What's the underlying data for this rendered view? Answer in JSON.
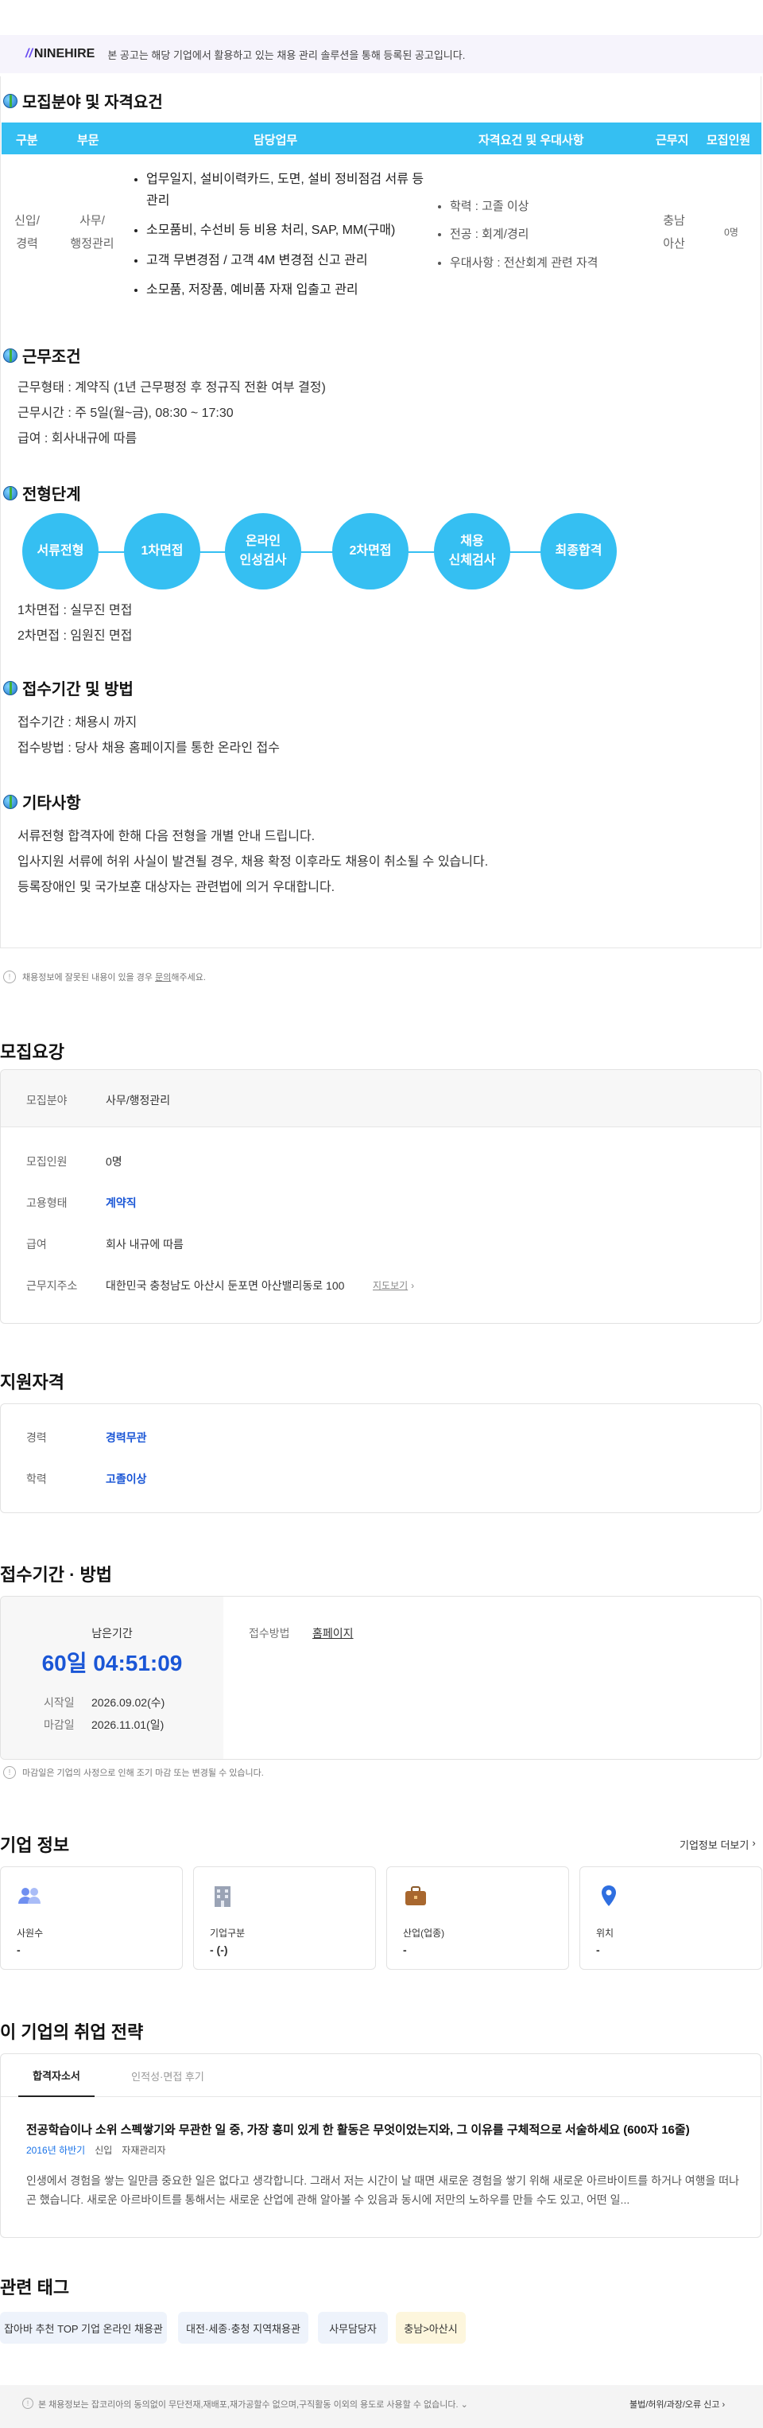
{
  "banner": {
    "logo": "NINEHIRE",
    "text": "본 공고는 해당 기업에서 활용하고 있는 채용 관리 솔루션을 통해 등록된 공고입니다."
  },
  "recruit": {
    "title": "모집분야 및 자격요건",
    "headers": [
      "구분",
      "부문",
      "담당업무",
      "자격요건 및 우대사항",
      "근무지",
      "모집인원"
    ],
    "row": {
      "type": "신입/\n경력",
      "dept": "사무/\n행정관리",
      "duties": [
        "업무일지, 설비이력카드, 도면, 설비 정비점검 서류 등 관리",
        "소모품비, 수선비 등 비용 처리, SAP, MM(구매)",
        "고객 무변경점 / 고객 4M 변경점 신고 관리",
        "소모품, 저장품, 예비품 자재 입출고 관리"
      ],
      "quals": [
        "학력 : 고졸 이상",
        "전공 : 회계/경리",
        "우대사항 : 전산회계 관련 자격"
      ],
      "location": "충남\n아산",
      "count": "0명"
    }
  },
  "conditions": {
    "title": "근무조건",
    "lines": [
      "근무형태 : 계약직 (1년 근무평정 후 정규직 전환 여부 결정)",
      "근무시간 : 주 5일(월~금), 08:30 ~ 17:30",
      "급여 : 회사내규에 따름"
    ]
  },
  "process": {
    "title": "전형단계",
    "steps": [
      "서류전형",
      "1차면접",
      "온라인\n인성검사",
      "2차면접",
      "채용\n신체검사",
      "최종합격"
    ],
    "lines": [
      "1차면접 : 실무진 면접",
      "2차면접 : 임원진 면접"
    ]
  },
  "apply": {
    "title": "접수기간 및 방법",
    "lines": [
      "접수기간 : 채용시 까지",
      "접수방법 : 당사 채용 홈페이지를 통한 온라인 접수"
    ]
  },
  "etc": {
    "title": "기타사항",
    "lines": [
      "서류전형 합격자에 한해 다음 전형을 개별 안내 드립니다.",
      "입사지원 서류에 허위 사실이 발견될 경우, 채용 확정 이후라도 채용이 취소될 수 있습니다.",
      "등록장애인 및 국가보훈 대상자는 관련법에 의거 우대합니다."
    ]
  },
  "notice1": {
    "pre": "채용정보에 잘못된 내용이 있을 경우 ",
    "link": "문의",
    "post": "해주세요."
  },
  "summary": {
    "title": "모집요강",
    "field_label": "모집분야",
    "field_value": "사무/행정관리",
    "rows": [
      {
        "label": "모집인원",
        "value": "0명"
      },
      {
        "label": "고용형태",
        "value": "계약직"
      },
      {
        "label": "급여",
        "value": "회사 내규에 따름"
      },
      {
        "label": "근무지주소",
        "value": "대한민국 충청남도 아산시 둔포면 아산밸리동로 100"
      }
    ],
    "map_link": "지도보기"
  },
  "qualify": {
    "title": "지원자격",
    "rows": [
      {
        "label": "경력",
        "value": "경력무관"
      },
      {
        "label": "학력",
        "value": "고졸이상"
      }
    ]
  },
  "period": {
    "title": "접수기간 · 방법",
    "remain_label": "남은기간",
    "remain": "60일 04:51:09",
    "start_label": "시작일",
    "start": "2026.09.02(수)",
    "end_label": "마감일",
    "end": "2026.11.01(일)",
    "method_label": "접수방법",
    "method": "홈페이지",
    "notice": "마감일은 기업의 사정으로 인해 조기 마감 또는 변경될 수 있습니다."
  },
  "company": {
    "title": "기업 정보",
    "more": "기업정보 더보기",
    "cards": [
      {
        "label": "사원수",
        "value": "-"
      },
      {
        "label": "기업구분",
        "value": "- (-)"
      },
      {
        "label": "산업(업종)",
        "value": "-"
      },
      {
        "label": "위치",
        "value": "-"
      }
    ]
  },
  "strategy": {
    "title": "이 기업의 취업 전략",
    "tabs": [
      "합격자소서",
      "인적성·면접 후기"
    ],
    "question": "전공학습이나 소위 스펙쌓기와 무관한 일 중, 가장 흥미 있게 한 활동은 무엇이었는지와, 그 이유를 구체적으로 서술하세요 (600자 16줄)",
    "meta": [
      "2016년 하반기",
      "신입",
      "자재관리자"
    ],
    "answer": "인생에서 경험을 쌓는 일만큼 중요한 일은 없다고 생각합니다. 그래서 저는 시간이 날 때면 새로운 경험을 쌓기 위해 새로운 아르바이트를 하거나 여행을 떠나곤 했습니다. 새로운 아르바이트를 통해서는 새로운 산업에 관해 알아볼 수 있음과 동시에 저만의 노하우를 만들 수도 있고, 어떤 일..."
  },
  "tags": {
    "title": "관련 태그",
    "items": [
      "잡아바 추천 TOP 기업 온라인 채용관",
      "대전·세종·충청 지역채용관",
      "사무담당자",
      "충남>아산시"
    ]
  },
  "footer": {
    "text": "본 채용정보는 잡코리아의 동의없이 무단전재,재배포,재가공할수 없으며,구직활동 이외의 용도로 사용할 수 없습니다.",
    "report": "불법/허위/과장/오류 신고"
  },
  "colors": {
    "accent": "#35bff2",
    "blue": "#1a56d6"
  }
}
